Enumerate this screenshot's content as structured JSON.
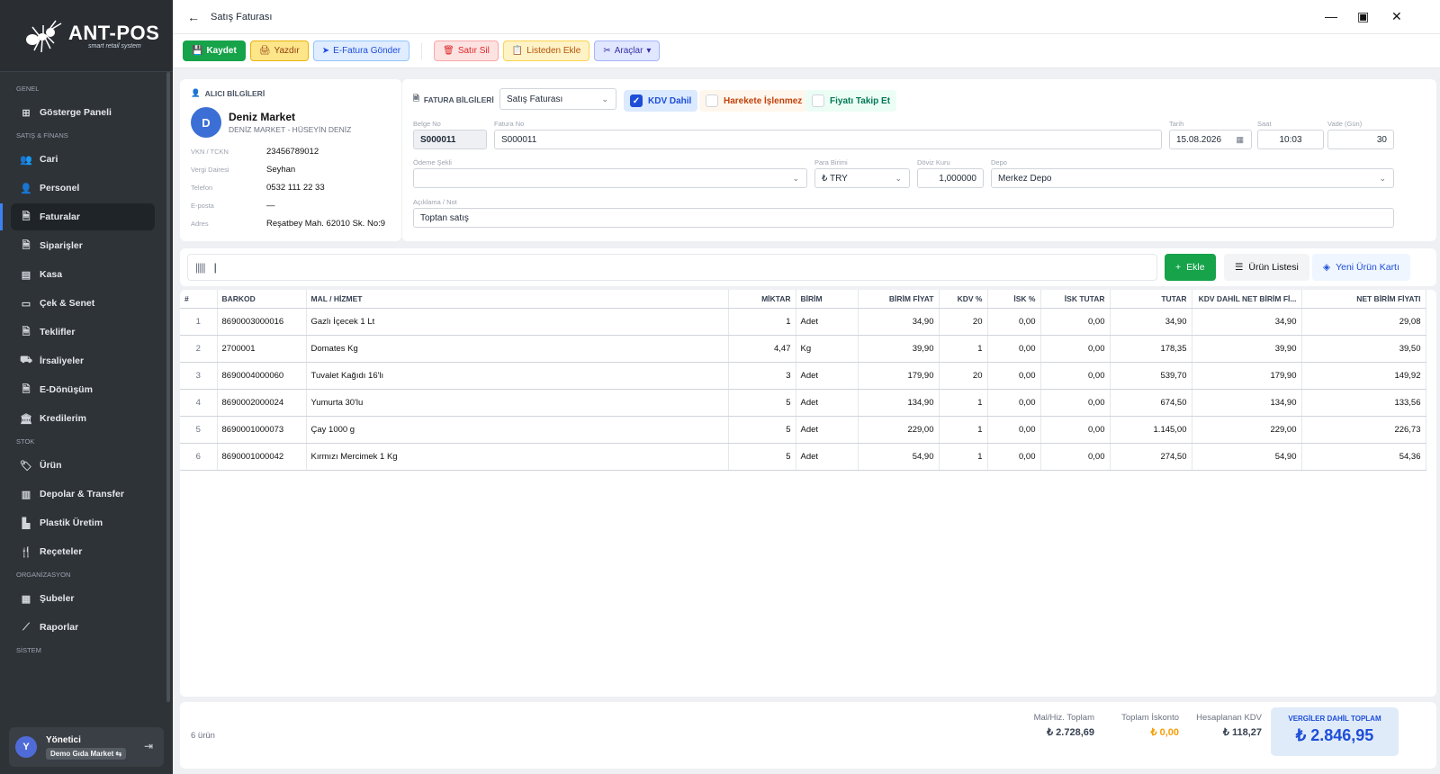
{
  "brand": {
    "name": "ANT-POS",
    "tagline": "smart retail system"
  },
  "sidebar": {
    "sections": [
      {
        "label": "GENEL",
        "items": [
          {
            "label": "Gösterge Paneli",
            "icon": "dashboard-icon"
          }
        ]
      },
      {
        "label": "SATIŞ & FİNANS",
        "items": [
          {
            "label": "Cari",
            "icon": "users-icon"
          },
          {
            "label": "Personel",
            "icon": "user-icon"
          },
          {
            "label": "Faturalar",
            "icon": "invoice-icon",
            "active": true
          },
          {
            "label": "Siparişler",
            "icon": "order-icon"
          },
          {
            "label": "Kasa",
            "icon": "cashbox-icon"
          },
          {
            "label": "Çek & Senet",
            "icon": "cheque-icon"
          },
          {
            "label": "Teklifler",
            "icon": "offer-icon"
          },
          {
            "label": "İrsaliyeler",
            "icon": "truck-icon"
          },
          {
            "label": "E-Dönüşüm",
            "icon": "e-document-icon"
          },
          {
            "label": "Kredilerim",
            "icon": "bank-icon"
          }
        ]
      },
      {
        "label": "STOK",
        "items": [
          {
            "label": "Ürün",
            "icon": "tag-icon"
          },
          {
            "label": "Depolar & Transfer",
            "icon": "warehouse-icon"
          },
          {
            "label": "Plastik Üretim",
            "icon": "factory-icon"
          },
          {
            "label": "Reçeteler",
            "icon": "recipe-icon"
          }
        ]
      },
      {
        "label": "ORGANİZASYON",
        "items": [
          {
            "label": "Şubeler",
            "icon": "branch-icon"
          },
          {
            "label": "Raporlar",
            "icon": "chart-icon"
          }
        ]
      },
      {
        "label": "SİSTEM",
        "items": []
      }
    ],
    "user": {
      "initial": "Y",
      "name": "Yönetici",
      "store": "Demo Gıda Market ⇆"
    }
  },
  "window": {
    "title": "Satış Faturası",
    "back": "←",
    "minimize": "—",
    "maximize": "▣",
    "close": "✕"
  },
  "toolbar": {
    "save": "Kaydet",
    "print": "Yazdır",
    "efatura": "E-Fatura Gönder",
    "delete_row": "Satır Sil",
    "add_from_list": "Listeden Ekle",
    "tools": "Araçlar"
  },
  "customer": {
    "section_label": "ALICI BİLGİLERİ",
    "initial": "D",
    "name": "Deniz Market",
    "subtitle": "DENİZ MARKET - HÜSEYİN DENİZ",
    "fields": [
      {
        "key": "VKN / TCKN",
        "value": "23456789012"
      },
      {
        "key": "Vergi Dairesi",
        "value": "Seyhan"
      },
      {
        "key": "Telefon",
        "value": "0532 111 22 33"
      },
      {
        "key": "E-posta",
        "value": "—"
      },
      {
        "key": "Adres",
        "value": "Reşatbey Mah. 62010 Sk. No:9"
      }
    ]
  },
  "invoice": {
    "section_label": "FATURA BİLGİLERİ",
    "type": "Satış Faturası",
    "kdv_dahil": "KDV Dahil",
    "harekete_islenmez": "Harekete İşlenmez",
    "fiyati_takip": "Fiyatı Takip Et",
    "belge_no_label": "Belge No",
    "belge_no": "S000011",
    "fatura_no_label": "Fatura No",
    "fatura_no": "S000011",
    "tarih_label": "Tarih",
    "tarih": "15.08.2026",
    "saat_label": "Saat",
    "saat": "10:03",
    "vade_label": "Vade (Gün)",
    "vade": "30",
    "odeme_label": "Ödeme Şekli",
    "odeme": "",
    "para_label": "Para Birimi",
    "para": "₺ TRY",
    "doviz_label": "Döviz Kuru",
    "doviz": "1,000000",
    "depo_label": "Depo",
    "depo": "Merkez Depo",
    "aciklama_label": "Açıklama / Not",
    "aciklama": "Toptan satış"
  },
  "scan": {
    "add": "Ekle",
    "product_list": "Ürün Listesi",
    "new_card": "Yeni Ürün Kartı"
  },
  "table": {
    "columns": [
      "#",
      "BARKOD",
      "MAL / HİZMET",
      "MİKTAR",
      "BİRİM",
      "BİRİM FİYAT",
      "KDV %",
      "İSK %",
      "İSK TUTAR",
      "TUTAR",
      "KDV DAHİL NET BİRİM Fİ...",
      "NET BİRİM FİYATI"
    ],
    "rows": [
      [
        "1",
        "8690003000016",
        "Gazlı İçecek 1 Lt",
        "1",
        "Adet",
        "34,90",
        "20",
        "0,00",
        "0,00",
        "34,90",
        "34,90",
        "29,08"
      ],
      [
        "2",
        "2700001",
        "Domates Kg",
        "4,47",
        "Kg",
        "39,90",
        "1",
        "0,00",
        "0,00",
        "178,35",
        "39,90",
        "39,50"
      ],
      [
        "3",
        "8690004000060",
        "Tuvalet Kağıdı 16'lı",
        "3",
        "Adet",
        "179,90",
        "20",
        "0,00",
        "0,00",
        "539,70",
        "179,90",
        "149,92"
      ],
      [
        "4",
        "8690002000024",
        "Yumurta 30'lu",
        "5",
        "Adet",
        "134,90",
        "1",
        "0,00",
        "0,00",
        "674,50",
        "134,90",
        "133,56"
      ],
      [
        "5",
        "8690001000073",
        "Çay 1000 g",
        "5",
        "Adet",
        "229,00",
        "1",
        "0,00",
        "0,00",
        "1.145,00",
        "229,00",
        "226,73"
      ],
      [
        "6",
        "8690001000042",
        "Kırmızı Mercimek 1 Kg",
        "5",
        "Adet",
        "54,90",
        "1",
        "0,00",
        "0,00",
        "274,50",
        "54,90",
        "54,36"
      ]
    ]
  },
  "footer": {
    "count": "6 ürün",
    "mal_label": "Mal/Hiz. Toplam",
    "mal_value": "₺ 2.728,69",
    "iskonto_label": "Toplam İskonto",
    "iskonto_value": "₺ 0,00",
    "kdv_label": "Hesaplanan KDV",
    "kdv_value": "₺ 118,27",
    "grand_label": "VERGİLER DAHİL TOPLAM",
    "grand_value": "₺ 2.846,95"
  },
  "colors": {
    "primary": "#16a34a",
    "accent": "#1d4ed8",
    "sidebar": "#2e3338",
    "discount": "#f59e0b"
  }
}
